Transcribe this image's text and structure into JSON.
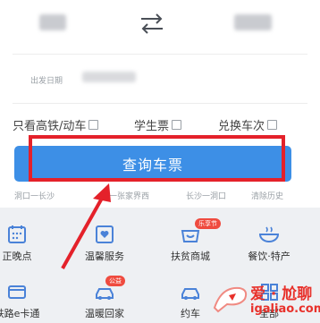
{
  "form": {
    "date_label": "出发日期",
    "options": [
      {
        "label": "只看高铁/动车"
      },
      {
        "label": "学生票"
      },
      {
        "label": "兑换车次"
      }
    ],
    "query_button": "查询车票",
    "history": [
      "洞口一长沙",
      "一张家界西",
      "长沙一洞口",
      "清除历史"
    ]
  },
  "services": {
    "row1": [
      {
        "label": "正晚点",
        "icon": "calendar-icon"
      },
      {
        "label": "温馨服务",
        "icon": "heart-box-icon"
      },
      {
        "label": "扶贫商城",
        "icon": "shop-icon",
        "tag": "乐享节"
      },
      {
        "label": "餐饮·特产",
        "icon": "bowl-icon"
      }
    ],
    "row2": [
      {
        "label": "e卡通",
        "prefix": "铁路",
        "icon": "card-icon"
      },
      {
        "label": "温暖回家",
        "icon": "car-icon",
        "tag": "公益"
      },
      {
        "label": "约车",
        "icon": "car-icon"
      },
      {
        "label": "全部",
        "icon": "grid-icon"
      }
    ]
  },
  "watermark": {
    "title": "爱 · 尬聊",
    "url": "igaliao.com"
  },
  "colors": {
    "accent": "#3d8fe6",
    "highlight": "#e4212a"
  }
}
